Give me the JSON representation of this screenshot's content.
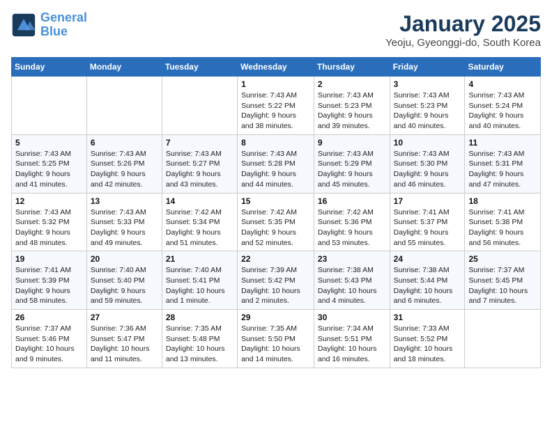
{
  "logo": {
    "line1": "General",
    "line2": "Blue"
  },
  "title": "January 2025",
  "subtitle": "Yeoju, Gyeonggi-do, South Korea",
  "weekdays": [
    "Sunday",
    "Monday",
    "Tuesday",
    "Wednesday",
    "Thursday",
    "Friday",
    "Saturday"
  ],
  "weeks": [
    [
      {
        "day": "",
        "info": ""
      },
      {
        "day": "",
        "info": ""
      },
      {
        "day": "",
        "info": ""
      },
      {
        "day": "1",
        "info": "Sunrise: 7:43 AM\nSunset: 5:22 PM\nDaylight: 9 hours and 38 minutes."
      },
      {
        "day": "2",
        "info": "Sunrise: 7:43 AM\nSunset: 5:23 PM\nDaylight: 9 hours and 39 minutes."
      },
      {
        "day": "3",
        "info": "Sunrise: 7:43 AM\nSunset: 5:23 PM\nDaylight: 9 hours and 40 minutes."
      },
      {
        "day": "4",
        "info": "Sunrise: 7:43 AM\nSunset: 5:24 PM\nDaylight: 9 hours and 40 minutes."
      }
    ],
    [
      {
        "day": "5",
        "info": "Sunrise: 7:43 AM\nSunset: 5:25 PM\nDaylight: 9 hours and 41 minutes."
      },
      {
        "day": "6",
        "info": "Sunrise: 7:43 AM\nSunset: 5:26 PM\nDaylight: 9 hours and 42 minutes."
      },
      {
        "day": "7",
        "info": "Sunrise: 7:43 AM\nSunset: 5:27 PM\nDaylight: 9 hours and 43 minutes."
      },
      {
        "day": "8",
        "info": "Sunrise: 7:43 AM\nSunset: 5:28 PM\nDaylight: 9 hours and 44 minutes."
      },
      {
        "day": "9",
        "info": "Sunrise: 7:43 AM\nSunset: 5:29 PM\nDaylight: 9 hours and 45 minutes."
      },
      {
        "day": "10",
        "info": "Sunrise: 7:43 AM\nSunset: 5:30 PM\nDaylight: 9 hours and 46 minutes."
      },
      {
        "day": "11",
        "info": "Sunrise: 7:43 AM\nSunset: 5:31 PM\nDaylight: 9 hours and 47 minutes."
      }
    ],
    [
      {
        "day": "12",
        "info": "Sunrise: 7:43 AM\nSunset: 5:32 PM\nDaylight: 9 hours and 48 minutes."
      },
      {
        "day": "13",
        "info": "Sunrise: 7:43 AM\nSunset: 5:33 PM\nDaylight: 9 hours and 49 minutes."
      },
      {
        "day": "14",
        "info": "Sunrise: 7:42 AM\nSunset: 5:34 PM\nDaylight: 9 hours and 51 minutes."
      },
      {
        "day": "15",
        "info": "Sunrise: 7:42 AM\nSunset: 5:35 PM\nDaylight: 9 hours and 52 minutes."
      },
      {
        "day": "16",
        "info": "Sunrise: 7:42 AM\nSunset: 5:36 PM\nDaylight: 9 hours and 53 minutes."
      },
      {
        "day": "17",
        "info": "Sunrise: 7:41 AM\nSunset: 5:37 PM\nDaylight: 9 hours and 55 minutes."
      },
      {
        "day": "18",
        "info": "Sunrise: 7:41 AM\nSunset: 5:38 PM\nDaylight: 9 hours and 56 minutes."
      }
    ],
    [
      {
        "day": "19",
        "info": "Sunrise: 7:41 AM\nSunset: 5:39 PM\nDaylight: 9 hours and 58 minutes."
      },
      {
        "day": "20",
        "info": "Sunrise: 7:40 AM\nSunset: 5:40 PM\nDaylight: 9 hours and 59 minutes."
      },
      {
        "day": "21",
        "info": "Sunrise: 7:40 AM\nSunset: 5:41 PM\nDaylight: 10 hours and 1 minute."
      },
      {
        "day": "22",
        "info": "Sunrise: 7:39 AM\nSunset: 5:42 PM\nDaylight: 10 hours and 2 minutes."
      },
      {
        "day": "23",
        "info": "Sunrise: 7:38 AM\nSunset: 5:43 PM\nDaylight: 10 hours and 4 minutes."
      },
      {
        "day": "24",
        "info": "Sunrise: 7:38 AM\nSunset: 5:44 PM\nDaylight: 10 hours and 6 minutes."
      },
      {
        "day": "25",
        "info": "Sunrise: 7:37 AM\nSunset: 5:45 PM\nDaylight: 10 hours and 7 minutes."
      }
    ],
    [
      {
        "day": "26",
        "info": "Sunrise: 7:37 AM\nSunset: 5:46 PM\nDaylight: 10 hours and 9 minutes."
      },
      {
        "day": "27",
        "info": "Sunrise: 7:36 AM\nSunset: 5:47 PM\nDaylight: 10 hours and 11 minutes."
      },
      {
        "day": "28",
        "info": "Sunrise: 7:35 AM\nSunset: 5:48 PM\nDaylight: 10 hours and 13 minutes."
      },
      {
        "day": "29",
        "info": "Sunrise: 7:35 AM\nSunset: 5:50 PM\nDaylight: 10 hours and 14 minutes."
      },
      {
        "day": "30",
        "info": "Sunrise: 7:34 AM\nSunset: 5:51 PM\nDaylight: 10 hours and 16 minutes."
      },
      {
        "day": "31",
        "info": "Sunrise: 7:33 AM\nSunset: 5:52 PM\nDaylight: 10 hours and 18 minutes."
      },
      {
        "day": "",
        "info": ""
      }
    ]
  ]
}
